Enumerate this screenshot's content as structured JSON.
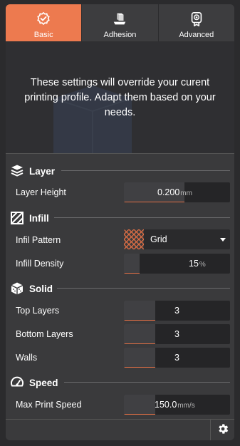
{
  "tabs": [
    {
      "label": "Basic",
      "icon": "badge-check-icon",
      "active": true
    },
    {
      "label": "Adhesion",
      "icon": "cube-on-plate-icon",
      "active": false
    },
    {
      "label": "Advanced",
      "icon": "award-ribbon-icon",
      "active": false
    }
  ],
  "notice": {
    "text": "These settings will override your curent printing profile. Adapt them based on your needs."
  },
  "sections": {
    "layer": {
      "title": "Layer",
      "icon": "layers-icon"
    },
    "infill": {
      "title": "Infill",
      "icon": "hatched-square-icon"
    },
    "solid": {
      "title": "Solid",
      "icon": "solid-cube-icon"
    },
    "speed": {
      "title": "Speed",
      "icon": "speedometer-icon"
    }
  },
  "fields": {
    "layer_height": {
      "label": "Layer Height",
      "value": "0.200",
      "unit": "mm",
      "fill": 0.57
    },
    "infill_pattern": {
      "label": "Infil Pattern",
      "value": "Grid"
    },
    "infill_density": {
      "label": "Infill Density",
      "value": "15",
      "unit": "%",
      "fill": 0.15
    },
    "top_layers": {
      "label": "Top Layers",
      "value": "3",
      "fill": 0.3
    },
    "bottom_layers": {
      "label": "Bottom Layers",
      "value": "3",
      "fill": 0.3
    },
    "walls": {
      "label": "Walls",
      "value": "3",
      "fill": 0.3
    },
    "max_print_speed": {
      "label": "Max Print Speed",
      "value": "150.0",
      "unit": "mm/s",
      "fill": 0.4
    }
  },
  "colors": {
    "accent": "#ed7a4f",
    "panel": "#3a3a3c",
    "field": "#252527"
  },
  "footer": {
    "icon": "gear-icon"
  }
}
